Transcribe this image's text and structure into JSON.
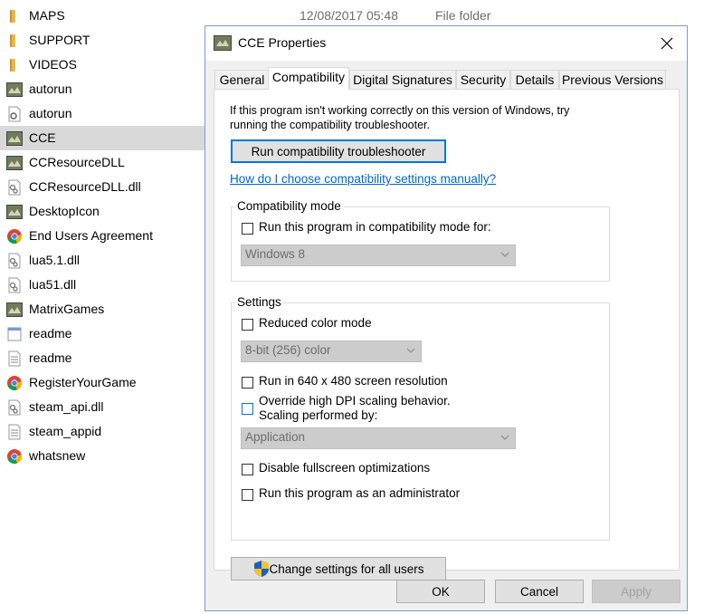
{
  "explorer": {
    "background_items": [
      {
        "text": "12/08/2017 05:48"
      },
      {
        "text": "File folder"
      }
    ],
    "items": [
      {
        "name": "MAPS",
        "icon": "folder-icon"
      },
      {
        "name": "SUPPORT",
        "icon": "folder-icon"
      },
      {
        "name": "VIDEOS",
        "icon": "folder-icon"
      },
      {
        "name": "autorun",
        "icon": "app-icon"
      },
      {
        "name": "autorun",
        "icon": "settings-file-icon"
      },
      {
        "name": "CCE",
        "icon": "app-icon"
      },
      {
        "name": "CCResourceDLL",
        "icon": "app-icon"
      },
      {
        "name": "CCResourceDLL.dll",
        "icon": "dll-file-icon"
      },
      {
        "name": "DesktopIcon",
        "icon": "app-icon"
      },
      {
        "name": "End Users Agreement",
        "icon": "chrome-icon"
      },
      {
        "name": "lua5.1.dll",
        "icon": "dll-file-icon"
      },
      {
        "name": "lua51.dll",
        "icon": "dll-file-icon"
      },
      {
        "name": "MatrixGames",
        "icon": "app-icon"
      },
      {
        "name": "readme",
        "icon": "window-file-icon"
      },
      {
        "name": "readme",
        "icon": "text-file-icon"
      },
      {
        "name": "RegisterYourGame",
        "icon": "chrome-icon"
      },
      {
        "name": "steam_api.dll",
        "icon": "dll-file-icon"
      },
      {
        "name": "steam_appid",
        "icon": "text-file-icon"
      },
      {
        "name": "whatsnew",
        "icon": "chrome-icon"
      }
    ],
    "selected_index": 5
  },
  "dialog": {
    "title": "CCE Properties",
    "tabs": [
      "General",
      "Compatibility",
      "Digital Signatures",
      "Security",
      "Details",
      "Previous Versions"
    ],
    "active_tab": "Compatibility",
    "intro_text": "If this program isn't working correctly on this version of Windows, try running the compatibility troubleshooter.",
    "troubleshooter_button": "Run compatibility troubleshooter",
    "manual_link": "How do I choose compatibility settings manually?",
    "compat_mode": {
      "label": "Compatibility mode",
      "checkbox_label": "Run this program in compatibility mode for:",
      "os_value": "Windows 8"
    },
    "settings": {
      "label": "Settings",
      "reduced_color": "Reduced color mode",
      "color_value": "8-bit (256) color",
      "resolution": "Run in 640 x 480 screen resolution",
      "dpi_line1": "Override high DPI scaling behavior.",
      "dpi_line2": "Scaling performed by:",
      "dpi_value": "Application",
      "fullscreen": "Disable fullscreen optimizations",
      "admin": "Run this program as an administrator"
    },
    "change_all_button": "Change settings for all users",
    "footer": {
      "ok": "OK",
      "cancel": "Cancel",
      "apply": "Apply"
    }
  },
  "colors": {
    "accent": "#0078d7",
    "link": "#0066cc",
    "selection": "#d9d9d9",
    "folder": "#e8b84a"
  }
}
